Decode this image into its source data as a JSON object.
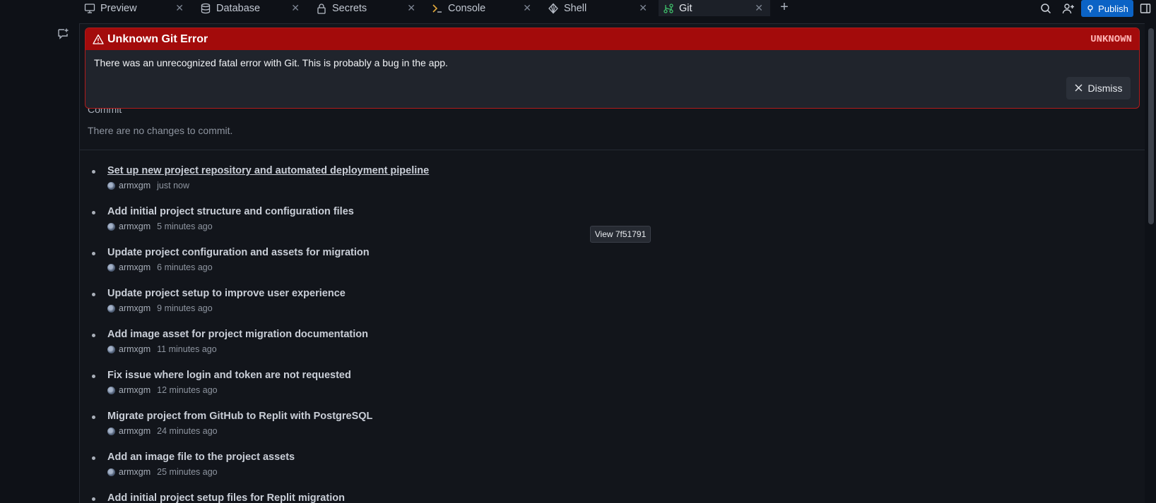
{
  "tabs": [
    {
      "label": "Preview",
      "icon": "monitor-icon"
    },
    {
      "label": "Database",
      "icon": "database-icon"
    },
    {
      "label": "Secrets",
      "icon": "lock-icon"
    },
    {
      "label": "Console",
      "icon": "console-icon"
    },
    {
      "label": "Shell",
      "icon": "shell-icon"
    },
    {
      "label": "Git",
      "icon": "git-icon",
      "active": true
    }
  ],
  "header": {
    "publish_label": "Publish",
    "accent_color": "#0b63c5"
  },
  "error": {
    "title": "Unknown Git Error",
    "code": "UNKNOWN",
    "message": "There was an unrecognized fatal error with Git. This is probably a bug in the app.",
    "dismiss_label": "Dismiss",
    "color": "#a30b0b"
  },
  "commit": {
    "heading": "Commit",
    "empty_text": "There are no changes to commit."
  },
  "tooltip": "View 7f51791",
  "history": [
    {
      "title": "Set up new project repository and automated deployment pipeline",
      "author": "armxgm",
      "time": "just now"
    },
    {
      "title": "Add initial project structure and configuration files",
      "author": "armxgm",
      "time": "5 minutes ago"
    },
    {
      "title": "Update project configuration and assets for migration",
      "author": "armxgm",
      "time": "6 minutes ago"
    },
    {
      "title": "Update project setup to improve user experience",
      "author": "armxgm",
      "time": "9 minutes ago"
    },
    {
      "title": "Add image asset for project migration documentation",
      "author": "armxgm",
      "time": "11 minutes ago"
    },
    {
      "title": "Fix issue where login and token are not requested",
      "author": "armxgm",
      "time": "12 minutes ago"
    },
    {
      "title": "Migrate project from GitHub to Replit with PostgreSQL",
      "author": "armxgm",
      "time": "24 minutes ago"
    },
    {
      "title": "Add an image file to the project assets",
      "author": "armxgm",
      "time": "25 minutes ago"
    },
    {
      "title": "Add initial project setup files for Replit migration",
      "author": "",
      "time": ""
    }
  ]
}
